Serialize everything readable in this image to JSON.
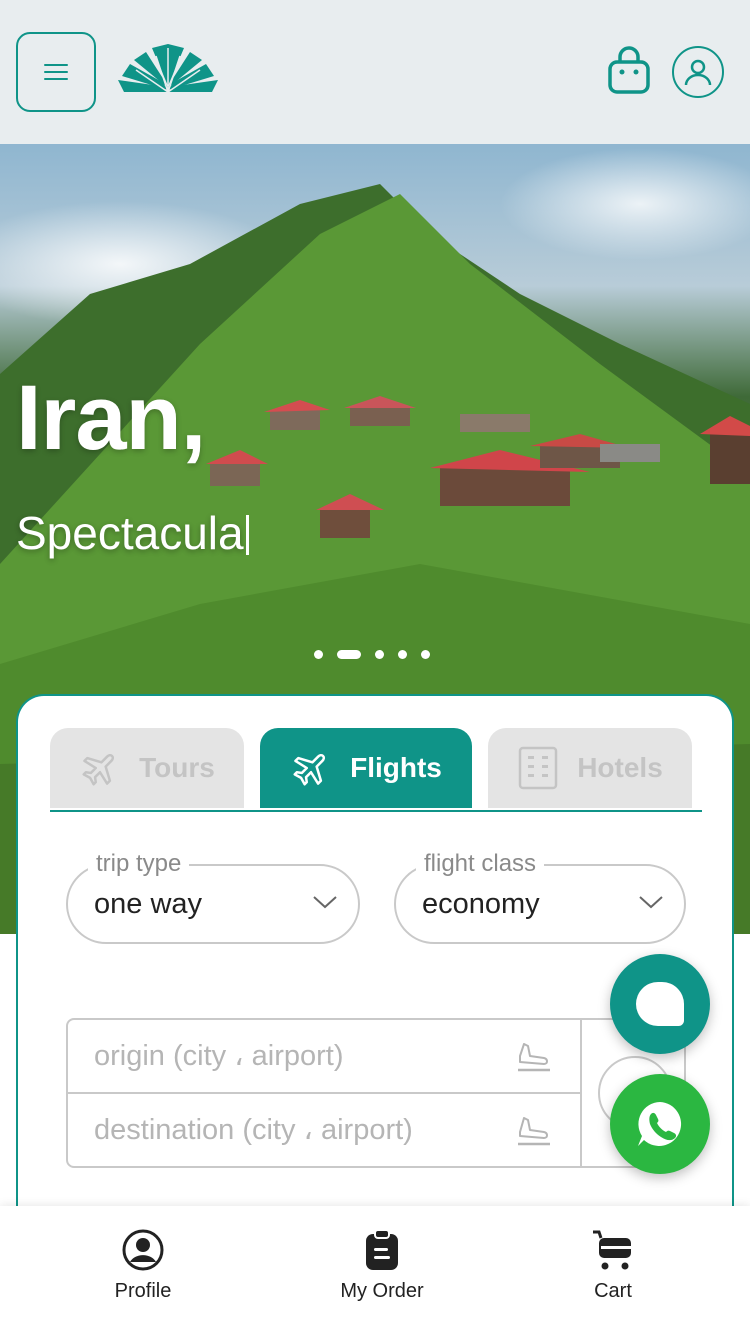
{
  "colors": {
    "accent": "#0f9488",
    "header_bg": "#e8edef",
    "whatsapp": "#2bb741",
    "tab_inactive_bg": "#e4e4e4"
  },
  "header": {
    "menu_icon": "hamburger-icon",
    "logo": "brand-logo",
    "bag_icon": "shopping-bag-icon",
    "user_icon": "user-icon"
  },
  "hero": {
    "title": "Iran,",
    "subtitle": "Spectacula",
    "slides_count": 5,
    "active_slide": 2
  },
  "search": {
    "tabs": [
      {
        "label": "Tours",
        "icon": "airplane-icon",
        "active": false
      },
      {
        "label": "Flights",
        "icon": "airplane-icon",
        "active": true
      },
      {
        "label": "Hotels",
        "icon": "building-icon",
        "active": false
      }
    ],
    "trip_type": {
      "legend": "trip type",
      "value": "one way"
    },
    "flight_class": {
      "legend": "flight class",
      "value": "economy"
    },
    "origin": {
      "placeholder": "origin (city ، airport)"
    },
    "destination": {
      "placeholder": "destination (city ، airport)"
    }
  },
  "fabs": {
    "chat_icon": "chat-bubble-icon",
    "whatsapp_icon": "whatsapp-icon"
  },
  "bottom_nav": {
    "items": [
      {
        "label": "Profile",
        "icon": "profile-icon"
      },
      {
        "label": "My Order",
        "icon": "clipboard-icon"
      },
      {
        "label": "Cart",
        "icon": "cart-icon"
      }
    ]
  }
}
